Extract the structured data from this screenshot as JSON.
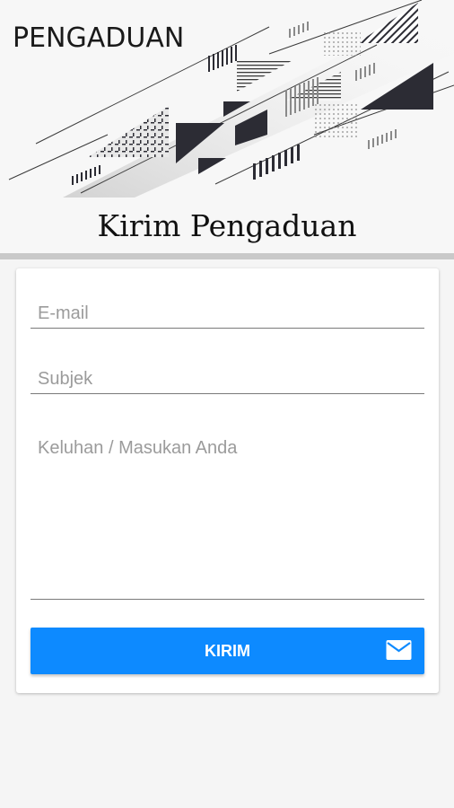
{
  "header": {
    "app_title": "PENGADUAN"
  },
  "page": {
    "heading": "Kirim Pengaduan"
  },
  "form": {
    "email": {
      "placeholder": "E-mail",
      "value": ""
    },
    "subject": {
      "placeholder": "Subjek",
      "value": ""
    },
    "message": {
      "placeholder": "Keluhan / Masukan Anda",
      "value": ""
    },
    "submit_label": "KIRIM",
    "submit_icon": "mail-icon"
  },
  "colors": {
    "accent": "#0d8aff",
    "background": "#f5f5f5",
    "card": "#ffffff",
    "divider": "#c9c9c9",
    "banner_dark": "#2c2c34"
  }
}
